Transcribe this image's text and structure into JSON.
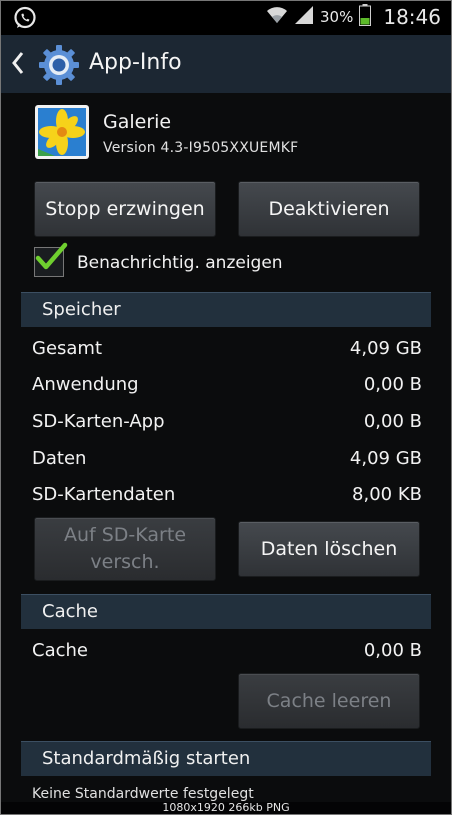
{
  "statusbar": {
    "battery": "30%",
    "time": "18:46"
  },
  "actionbar": {
    "title": "App-Info"
  },
  "app": {
    "name": "Galerie",
    "version": "Version 4.3-I9505XXUEMKF"
  },
  "buttons": {
    "force_stop": "Stopp erzwingen",
    "disable": "Deaktivieren",
    "move_sd_line1": "Auf SD-Karte",
    "move_sd_line2": "versch.",
    "clear_data": "Daten löschen",
    "clear_cache": "Cache leeren"
  },
  "notifications": {
    "label": "Benachrichtig. anzeigen",
    "checked": true
  },
  "storage": {
    "header": "Speicher",
    "rows": [
      {
        "label": "Gesamt",
        "value": "4,09 GB"
      },
      {
        "label": "Anwendung",
        "value": "0,00 B"
      },
      {
        "label": "SD-Karten-App",
        "value": "0,00 B"
      },
      {
        "label": "Daten",
        "value": "4,09 GB"
      },
      {
        "label": "SD-Kartendaten",
        "value": "8,00 KB"
      }
    ]
  },
  "cache": {
    "header": "Cache",
    "label": "Cache",
    "value": "0,00 B"
  },
  "defaults": {
    "header": "Standardmäßig starten",
    "text": "Keine Standardwerte festgelegt"
  },
  "watermark": "1080x1920  266kb  PNG",
  "colors": {
    "background": "#0b0c0d",
    "actionbar": "#1c2733",
    "section": "#22303d",
    "check": "#6fcf2f"
  }
}
